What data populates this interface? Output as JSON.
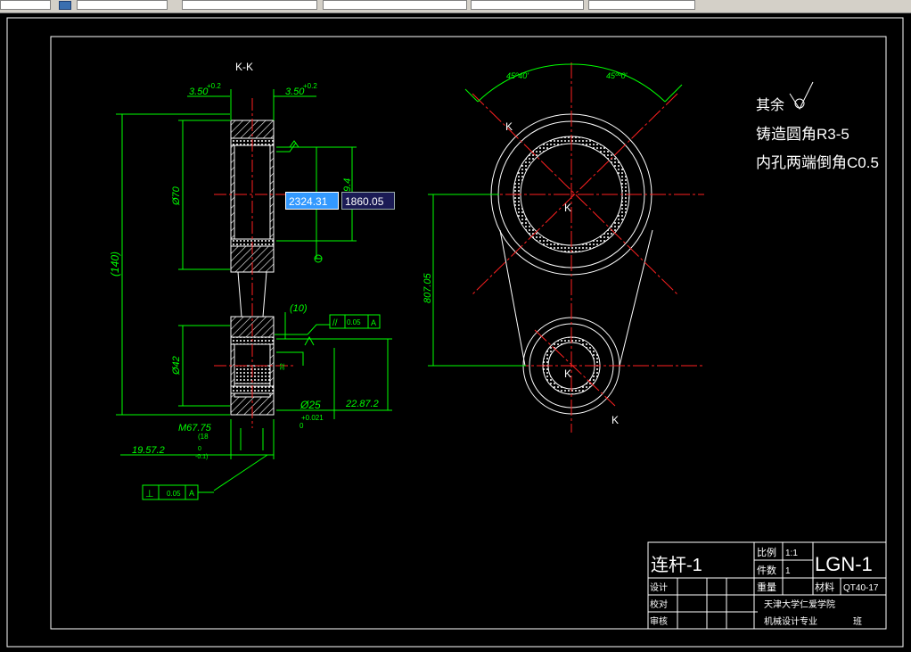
{
  "toolbar": {
    "fields": [
      "",
      "",
      "",
      "",
      "",
      ""
    ]
  },
  "input": {
    "x_value": "2324.31",
    "y_value": "1860.05"
  },
  "drawing": {
    "section_label": "K-K",
    "dims_left": {
      "top_left": "3.50",
      "top_left_tol": "+0.2",
      "top_right": "3.50",
      "top_right_tol": "+0.2",
      "d70": "Ø70",
      "d42": "Ø42",
      "len140": "(140)",
      "d25": "Ø25",
      "d25_tol_up": "+0.021",
      "d25_tol_low": "0",
      "p10": "(10)",
      "m67": "M67.75",
      "m18": "(18",
      "r195": "19.57.2",
      "r195_tol": "0",
      "r195_tol2": "-0.1)",
      "r228": "22.87.2",
      "side_small": "9.4",
      "small_num": "32"
    },
    "gdt": {
      "parallel": "//",
      "parallel_val": "0.05",
      "parallel_ref": "A",
      "perp": "⊥",
      "perp_val": "0.05",
      "perp_ref": "A"
    },
    "dims_right": {
      "angle_left": "45º40'",
      "angle_right": "45ºº0'",
      "dist": "807.05",
      "k1": "K",
      "k2": "K",
      "k3": "K",
      "k4": "K"
    },
    "notes": {
      "line1": "其余",
      "line2": "铸造圆角R3-5",
      "line3": "内孔两端倒角C0.5"
    },
    "title_block": {
      "name": "连杆-1",
      "scale_label": "比例",
      "scale_value": "1:1",
      "count_label": "件数",
      "count_value": "1",
      "weight_label": "重量",
      "material_label": "材料",
      "material_value": "QT40-17",
      "code": "LGN-1",
      "design": "设计",
      "check": "校对",
      "approve": "审核",
      "school": "天津大学仁爱学院",
      "major": "机械设计专业",
      "class": "班"
    }
  },
  "colors": {
    "green": "#00ff00",
    "red": "#ff2020",
    "white": "#ffffff",
    "background": "#000000"
  }
}
